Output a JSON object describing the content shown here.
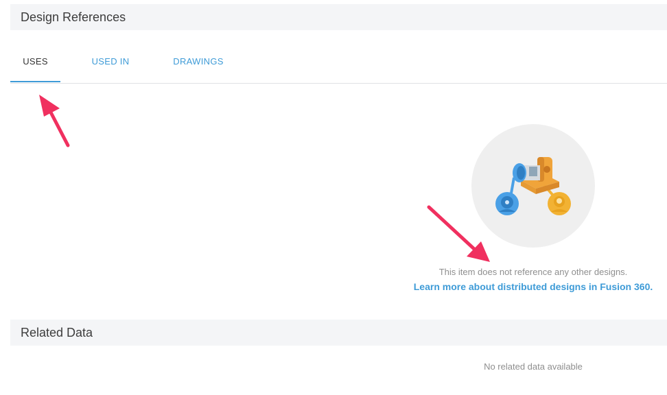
{
  "design_references": {
    "title": "Design References",
    "tabs": [
      {
        "label": "USES",
        "active": true
      },
      {
        "label": "USED IN",
        "active": false
      },
      {
        "label": "DRAWINGS",
        "active": false
      }
    ],
    "empty_message": "This item does not reference any other designs.",
    "learn_more_link": "Learn more about distributed designs in Fusion 360."
  },
  "related_data": {
    "title": "Related Data",
    "empty_message": "No related data available"
  },
  "colors": {
    "accent": "#3e9bd7",
    "annotation_arrow": "#f0305f",
    "header_bg": "#f4f5f7"
  }
}
